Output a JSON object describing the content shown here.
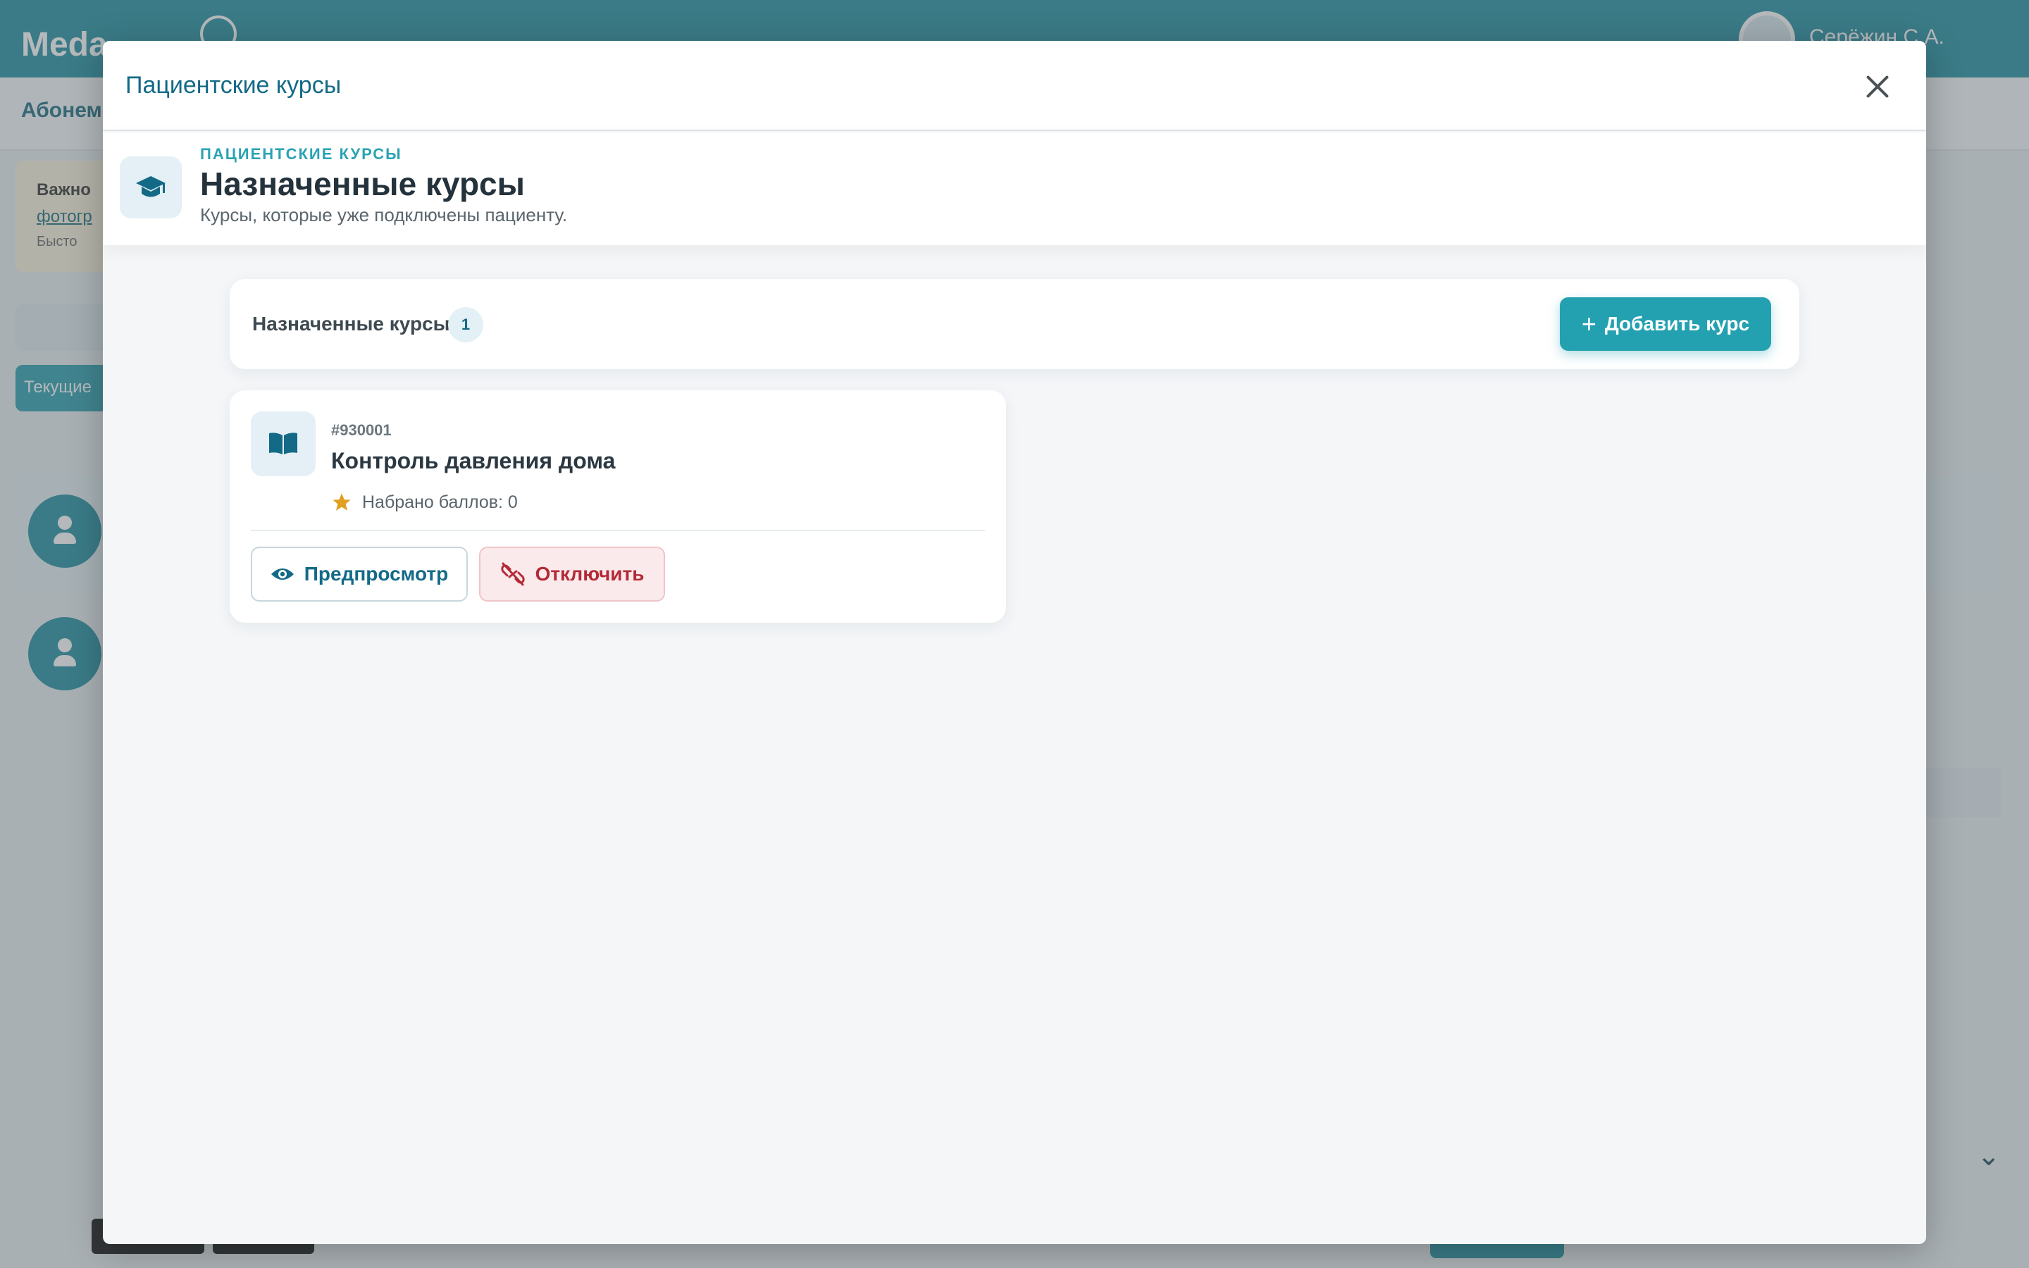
{
  "background": {
    "logo": "Meda",
    "user_name": "Серёжин С.А.",
    "subbar_label": "Абонем",
    "warning_title": "Важно",
    "warning_link": "фотогр",
    "warning_text": "Бысто",
    "active_tab": "Текущие"
  },
  "modal": {
    "title": "Пациентские курсы",
    "close_icon": "close-icon"
  },
  "hero": {
    "icon": "graduation-cap-icon",
    "eyebrow": "ПАЦИЕНТСКИЕ КУРСЫ",
    "title": "Назначенные курсы",
    "subtitle": "Курсы, которые уже подключены пациенту."
  },
  "toolbar": {
    "label": "Назначенные курсы",
    "count": "1",
    "add_button": "Добавить курс",
    "add_icon": "plus-icon"
  },
  "courses": [
    {
      "icon": "book-icon",
      "id": "#930001",
      "name": "Контроль давления дома",
      "points_label": "Набрано баллов: 0",
      "points_icon": "star-icon",
      "preview_label": "Предпросмотр",
      "preview_icon": "eye-icon",
      "disconnect_label": "Отключить",
      "disconnect_icon": "unlink-icon"
    }
  ],
  "colors": {
    "brand": "#1f8ea0",
    "accent": "#24a1b1",
    "danger": "#b32a36",
    "star": "#e0a020"
  }
}
